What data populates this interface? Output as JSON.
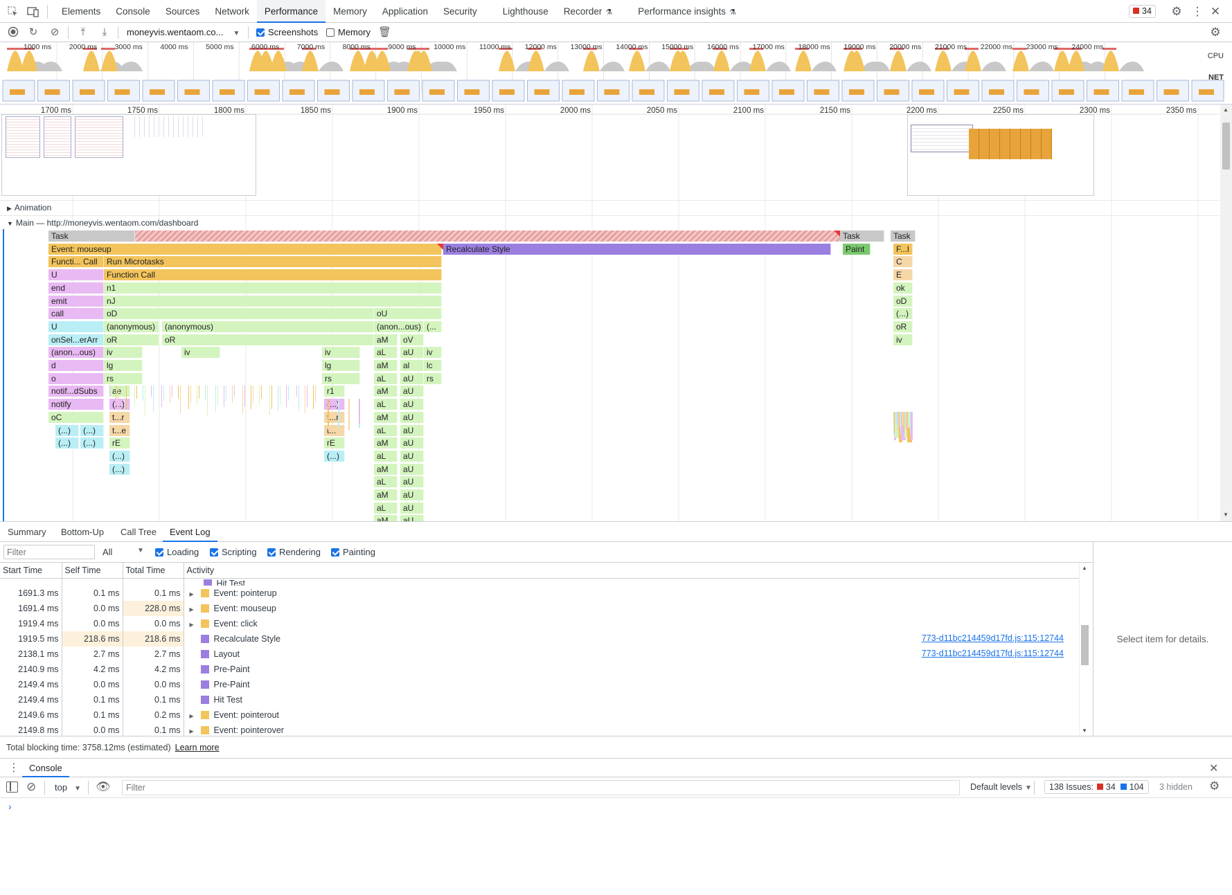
{
  "devtools": {
    "tabs": [
      "Elements",
      "Console",
      "Sources",
      "Network",
      "Performance",
      "Memory",
      "Application",
      "Security",
      "Lighthouse",
      "Recorder",
      "Performance insights"
    ],
    "active_tab": "Performance",
    "issue_count": "34"
  },
  "toolbar": {
    "url_select": "moneyvis.wentaom.co...",
    "screenshots_label": "Screenshots",
    "memory_label": "Memory"
  },
  "overview": {
    "ticks": [
      "1000 ms",
      "2000 ms",
      "3000 ms",
      "4000 ms",
      "5000 ms",
      "6000 ms",
      "7000 ms",
      "8000 ms",
      "9000 ms",
      "10000 ms",
      "11000 ms",
      "12000 ms",
      "13000 ms",
      "14000 ms",
      "15000 ms",
      "16000 ms",
      "17000 ms",
      "18000 ms",
      "19000 ms",
      "20000 ms",
      "21000 ms",
      "22000 ms",
      "23000 ms",
      "24000 ms"
    ],
    "cpu_label": "CPU",
    "net_label": "NET"
  },
  "timeline": {
    "ticks": [
      "1700 ms",
      "1750 ms",
      "1800 ms",
      "1850 ms",
      "1900 ms",
      "1950 ms",
      "2000 ms",
      "2050 ms",
      "2100 ms",
      "2150 ms",
      "2200 ms",
      "2250 ms",
      "2300 ms",
      "2350 ms"
    ],
    "animation_track": "Animation",
    "main_track": "Main — http://moneyvis.wentaom.com/dashboard",
    "flame": {
      "task1": "Task",
      "task2": "Task",
      "task3": "Task",
      "event_mouseup": "Event: mouseup",
      "recalc": "Recalculate Style",
      "paint": "Paint",
      "f_small": "F...l",
      "func_call_short": "Functi... Call",
      "run_microtasks": "Run Microtasks",
      "u1": "U",
      "function_call": "Function Call",
      "end": "end",
      "n1": "n1",
      "emit": "emit",
      "nJ": "nJ",
      "call": "call",
      "oD": "oD",
      "oU": "oU",
      "u2": "U",
      "anon1": "(anonymous)",
      "anon2": "(anonymous)",
      "anon3": "(anon...ous)",
      "anon4": "(...",
      "onsel": "onSel...erArr",
      "oR1": "oR",
      "oR2": "oR",
      "aM": "aM",
      "oV": "oV",
      "anon5": "(anon...ous)",
      "iv": "iv",
      "aL": "aL",
      "aU": "aU",
      "d": "d",
      "lg": "lg",
      "al": "al",
      "lc": "lc",
      "o": "o",
      "rs": "rs",
      "notifsubs": "notif...dSubs",
      "ae": "ae",
      "r1": "r1",
      "notify": "notify",
      "paren": "(...)",
      "oC": "oC",
      "tr": "t...r",
      "te": "t...e",
      "t": "t...",
      "rE": "rE",
      "C": "C",
      "E": "E",
      "ok": "ok",
      "oD2": "oD"
    }
  },
  "bottom": {
    "tabs": [
      "Summary",
      "Bottom-Up",
      "Call Tree",
      "Event Log"
    ],
    "active": "Event Log",
    "filter_placeholder": "Filter",
    "all_select": "All",
    "categories": [
      "Loading",
      "Scripting",
      "Rendering",
      "Painting"
    ],
    "columns": [
      "Start Time",
      "Self Time",
      "Total Time",
      "Activity"
    ],
    "rows": [
      {
        "start": "1691.3 ms",
        "self": "0.1 ms",
        "total": "0.1 ms",
        "activity": "Event: pointerup",
        "color": "#f2c45b",
        "expand": true,
        "link": ""
      },
      {
        "start": "1691.4 ms",
        "self": "0.0 ms",
        "total": "228.0 ms",
        "activity": "Event: mouseup",
        "color": "#f2c45b",
        "expand": true,
        "link": "",
        "hl_total": true
      },
      {
        "start": "1919.4 ms",
        "self": "0.0 ms",
        "total": "0.0 ms",
        "activity": "Event: click",
        "color": "#f2c45b",
        "expand": true,
        "link": ""
      },
      {
        "start": "1919.5 ms",
        "self": "218.6 ms",
        "total": "218.6 ms",
        "activity": "Recalculate Style",
        "color": "#9b7fe0",
        "expand": false,
        "link": "773-d11bc214459d17fd.js:115:12744",
        "hl_self": true,
        "hl_total": true
      },
      {
        "start": "2138.1 ms",
        "self": "2.7 ms",
        "total": "2.7 ms",
        "activity": "Layout",
        "color": "#9b7fe0",
        "expand": false,
        "link": "773-d11bc214459d17fd.js:115:12744"
      },
      {
        "start": "2140.9 ms",
        "self": "4.2 ms",
        "total": "4.2 ms",
        "activity": "Pre-Paint",
        "color": "#9b7fe0",
        "expand": false,
        "link": ""
      },
      {
        "start": "2149.4 ms",
        "self": "0.0 ms",
        "total": "0.0 ms",
        "activity": "Pre-Paint",
        "color": "#9b7fe0",
        "expand": false,
        "link": ""
      },
      {
        "start": "2149.4 ms",
        "self": "0.1 ms",
        "total": "0.1 ms",
        "activity": "Hit Test",
        "color": "#9b7fe0",
        "expand": false,
        "link": ""
      },
      {
        "start": "2149.6 ms",
        "self": "0.1 ms",
        "total": "0.2 ms",
        "activity": "Event: pointerout",
        "color": "#f2c45b",
        "expand": true,
        "link": ""
      },
      {
        "start": "2149.8 ms",
        "self": "0.0 ms",
        "total": "0.1 ms",
        "activity": "Event: pointerover",
        "color": "#f2c45b",
        "expand": true,
        "link": ""
      }
    ],
    "hidden_row_activity": "Hit Test",
    "details_placeholder": "Select item for details.",
    "tbt_text": "Total blocking time: 3758.12ms (estimated)",
    "learn_more": "Learn more"
  },
  "drawer": {
    "title": "Console",
    "context": "top",
    "filter_placeholder": "Filter",
    "levels": "Default levels",
    "issues_label": "138 Issues:",
    "errors": "34",
    "infos": "104",
    "hidden": "3 hidden"
  },
  "colors": {
    "accent": "#1a73e8",
    "scripting": "#f2c45b",
    "rendering": "#9b7fe0",
    "painting": "#7bc96f",
    "green_fn": "#d4f4bf",
    "pink_fn": "#e9b9f3",
    "cyan_fn": "#b9eef5",
    "task_gray": "#c8c8c8"
  }
}
